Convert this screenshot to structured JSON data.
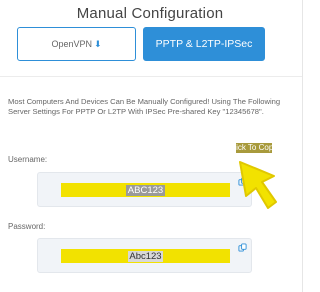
{
  "page": {
    "title": "Manual Configuration"
  },
  "tabs": {
    "openvpn_label": "OpenVPN",
    "pptp_label": "PPTP & L2TP-IPSec"
  },
  "description": "Most Computers And Devices Can Be Manually Configured! Using The Following Server Settings For PPTP Or L2TP With IPSec Pre-shared Key \"12345678\".",
  "username": {
    "label": "Username:",
    "value": "ABC123"
  },
  "password": {
    "label": "Password:",
    "value": "Abc123"
  },
  "callout": {
    "text": "Click To Copy!"
  },
  "icons": {
    "openvpn_glyph": "download-arrow-icon",
    "copy": "copy-icon",
    "pointer": "arrow-pointer-icon"
  },
  "colors": {
    "accent": "#2e8fd8",
    "highlight": "#f2e200",
    "callout_bg": "#a89a3c"
  }
}
